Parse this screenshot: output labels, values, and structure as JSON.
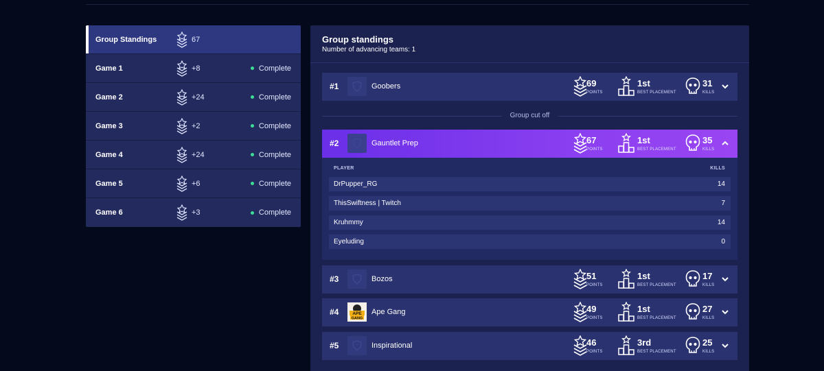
{
  "standings_nav": [
    {
      "name": "Group Standings",
      "points": "67",
      "status": ""
    },
    {
      "name": "Game 1",
      "points": "+8",
      "status": "Complete"
    },
    {
      "name": "Game 2",
      "points": "+24",
      "status": "Complete"
    },
    {
      "name": "Game 3",
      "points": "+2",
      "status": "Complete"
    },
    {
      "name": "Game 4",
      "points": "+24",
      "status": "Complete"
    },
    {
      "name": "Game 5",
      "points": "+6",
      "status": "Complete"
    },
    {
      "name": "Game 6",
      "points": "+3",
      "status": "Complete"
    }
  ],
  "panel": {
    "title": "Group standings",
    "subtitle": "Number of advancing teams: 1",
    "cutoff_label": "Group cut off"
  },
  "stat_labels": {
    "points": "POINTS",
    "placement": "BEST PLACEMENT",
    "kills": "KILLS"
  },
  "teams": [
    {
      "rank": "#1",
      "name": "Goobers",
      "points": "69",
      "placement": "1st",
      "kills": "31"
    },
    {
      "rank": "#2",
      "name": "Gauntlet Prep",
      "points": "67",
      "placement": "1st",
      "kills": "35"
    },
    {
      "rank": "#3",
      "name": "Bozos",
      "points": "51",
      "placement": "1st",
      "kills": "17"
    },
    {
      "rank": "#4",
      "name": "Ape Gang",
      "points": "49",
      "placement": "1st",
      "kills": "27"
    },
    {
      "rank": "#5",
      "name": "Inspirational",
      "points": "46",
      "placement": "3rd",
      "kills": "25"
    }
  ],
  "player_table": {
    "header_player": "PLAYER",
    "header_kills": "KILLS",
    "rows": [
      {
        "player": "DrPupper_RG",
        "kills": "14"
      },
      {
        "player": "ThisSwiftness | Twitch",
        "kills": "7"
      },
      {
        "player": "Kruhmmy",
        "kills": "14"
      },
      {
        "player": "Eyeluding",
        "kills": "0"
      }
    ]
  },
  "ape_logo_text": [
    "APE",
    "GANG"
  ],
  "colors": {
    "background": "#040a1c",
    "panel": "#1b2250",
    "row": "#2a3270",
    "expanded_row": "#8a3ff0",
    "status_dot": "#3ddc97"
  }
}
